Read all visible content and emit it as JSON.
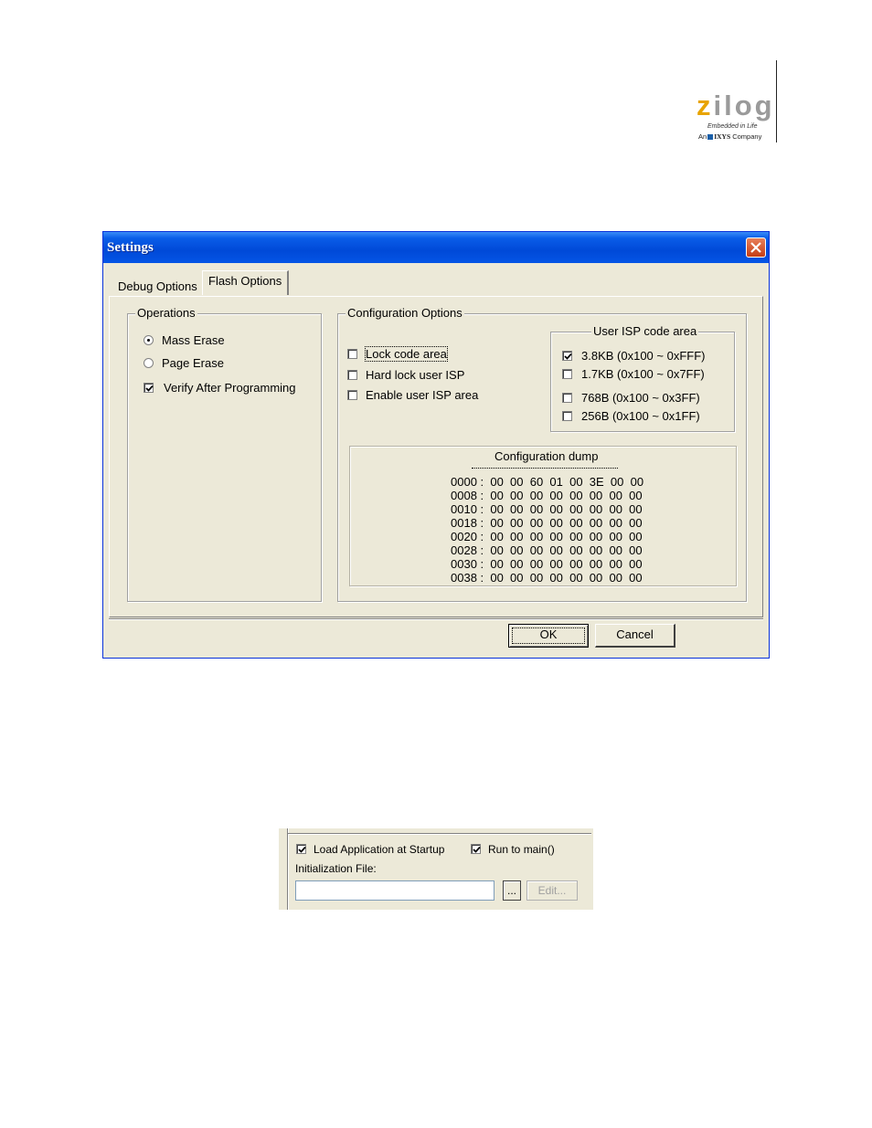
{
  "logo": {
    "word_initial": "z",
    "word_rest": "ilog",
    "tagline": "Embedded in Life",
    "sub_prefix": "An",
    "sub_brand": "IXYS",
    "sub_suffix": "Company",
    "colors": {
      "z": "#e8a400",
      "ilog": "#9a9a9a",
      "ixys_square": "#1a5fa8"
    }
  },
  "dialog": {
    "title": "Settings",
    "tabs": [
      {
        "label": "Debug Options",
        "selected": false
      },
      {
        "label": "Flash Options",
        "selected": true
      }
    ],
    "operations": {
      "title": "Operations",
      "mass_erase": {
        "label": "Mass Erase",
        "selected": true
      },
      "page_erase": {
        "label": "Page Erase",
        "selected": false
      },
      "verify": {
        "label": "Verify After Programming",
        "checked": true
      }
    },
    "config": {
      "title": "Configuration Options",
      "lock_code": {
        "label": "Lock code area",
        "checked": false
      },
      "hard_lock": {
        "label": "Hard lock user ISP",
        "checked": false
      },
      "enable_isp": {
        "label": "Enable user ISP area",
        "checked": false
      },
      "isp_area": {
        "title": "User ISP code area",
        "options": [
          {
            "label": "3.8KB (0x100 ~ 0xFFF)",
            "checked": true
          },
          {
            "label": "1.7KB (0x100 ~ 0x7FF)",
            "checked": false
          },
          {
            "label": "768B (0x100 ~ 0x3FF)",
            "checked": false
          },
          {
            "label": "256B (0x100 ~ 0x1FF)",
            "checked": false
          }
        ]
      },
      "dump": {
        "title": "Configuration dump",
        "lines": [
          "0000 :  00  00  60  01  00  3E  00  00",
          "0008 :  00  00  00  00  00  00  00  00",
          "0010 :  00  00  00  00  00  00  00  00",
          "0018 :  00  00  00  00  00  00  00  00",
          "0020 :  00  00  00  00  00  00  00  00",
          "0028 :  00  00  00  00  00  00  00  00",
          "0030 :  00  00  00  00  00  00  00  00",
          "0038 :  00  00  00  00  00  00  00  00"
        ]
      }
    },
    "ok_label": "OK",
    "cancel_label": "Cancel"
  },
  "snippet": {
    "load_app": {
      "label": "Load Application at Startup",
      "checked": true
    },
    "run_main": {
      "label": "Run to main()",
      "checked": true
    },
    "init_file_label": "Initialization File:",
    "init_file_value": "",
    "browse_label": "...",
    "edit_label": "Edit..."
  }
}
